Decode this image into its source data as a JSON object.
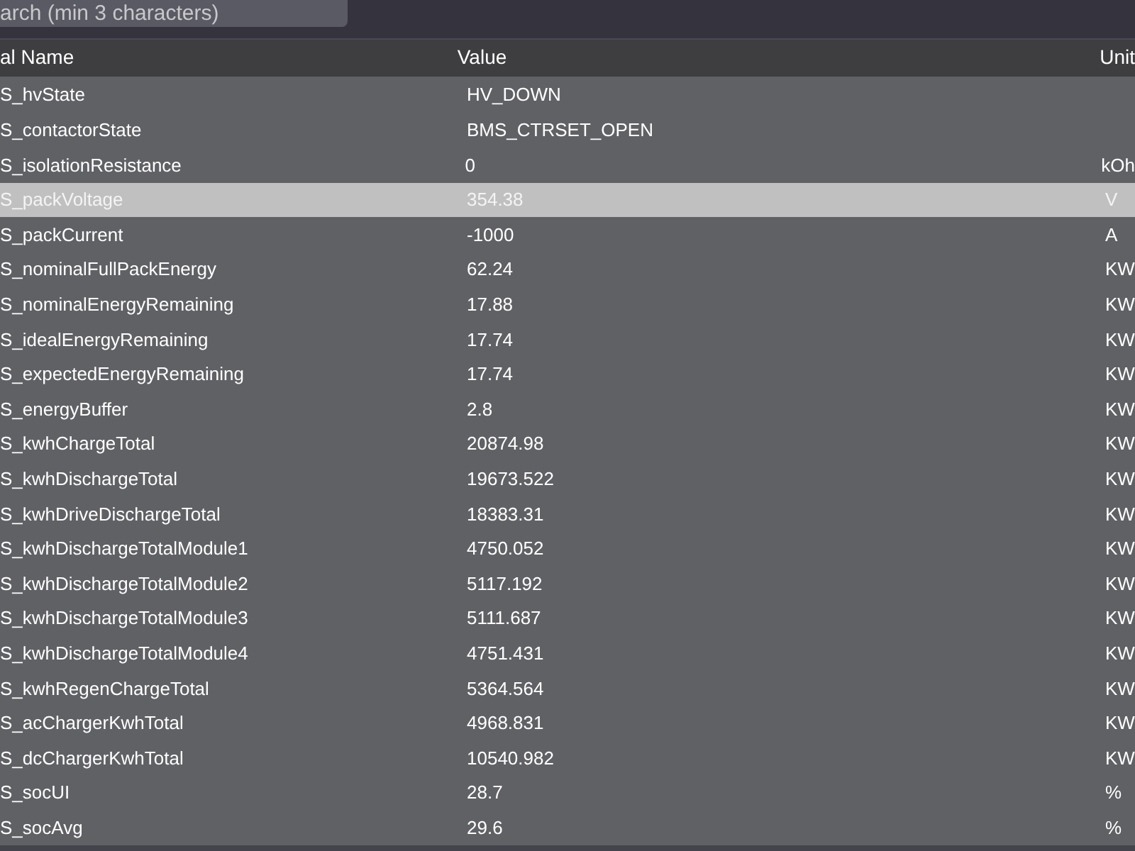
{
  "search": {
    "placeholder": "arch (min 3 characters)"
  },
  "table": {
    "columns": [
      "al Name",
      "Value",
      "Unit"
    ],
    "rows": [
      {
        "name": "S_hvState",
        "value": "HV_DOWN",
        "unit": "",
        "selected": false
      },
      {
        "name": "S_contactorState",
        "value": "BMS_CTRSET_OPEN",
        "unit": "",
        "selected": false
      },
      {
        "name": "S_isolationResistance",
        "value": "0",
        "unit": "kOh",
        "selected": false
      },
      {
        "name": "S_packVoltage",
        "value": "354.38",
        "unit": "V",
        "selected": true
      },
      {
        "name": "S_packCurrent",
        "value": "-1000",
        "unit": "A",
        "selected": false
      },
      {
        "name": "S_nominalFullPackEnergy",
        "value": "62.24",
        "unit": "KW",
        "selected": false
      },
      {
        "name": "S_nominalEnergyRemaining",
        "value": "17.88",
        "unit": "KW",
        "selected": false
      },
      {
        "name": "S_idealEnergyRemaining",
        "value": "17.74",
        "unit": "KW",
        "selected": false
      },
      {
        "name": "S_expectedEnergyRemaining",
        "value": "17.74",
        "unit": "KW",
        "selected": false
      },
      {
        "name": "S_energyBuffer",
        "value": "2.8",
        "unit": "KW",
        "selected": false
      },
      {
        "name": "S_kwhChargeTotal",
        "value": "20874.98",
        "unit": "KW",
        "selected": false
      },
      {
        "name": "S_kwhDischargeTotal",
        "value": "19673.522",
        "unit": "KW",
        "selected": false
      },
      {
        "name": "S_kwhDriveDischargeTotal",
        "value": "18383.31",
        "unit": "KW",
        "selected": false
      },
      {
        "name": "S_kwhDischargeTotalModule1",
        "value": "4750.052",
        "unit": "KW",
        "selected": false
      },
      {
        "name": "S_kwhDischargeTotalModule2",
        "value": "5117.192",
        "unit": "KW",
        "selected": false
      },
      {
        "name": "S_kwhDischargeTotalModule3",
        "value": "5111.687",
        "unit": "KW",
        "selected": false
      },
      {
        "name": "S_kwhDischargeTotalModule4",
        "value": "4751.431",
        "unit": "KW",
        "selected": false
      },
      {
        "name": "S_kwhRegenChargeTotal",
        "value": "5364.564",
        "unit": "KW",
        "selected": false
      },
      {
        "name": "S_acChargerKwhTotal",
        "value": "4968.831",
        "unit": "KW",
        "selected": false
      },
      {
        "name": "S_dcChargerKwhTotal",
        "value": "10540.982",
        "unit": "KW",
        "selected": false
      },
      {
        "name": "S_socUI",
        "value": "28.7",
        "unit": "%",
        "selected": false
      },
      {
        "name": "S_socAvg",
        "value": "29.6",
        "unit": "%",
        "selected": false
      }
    ]
  }
}
